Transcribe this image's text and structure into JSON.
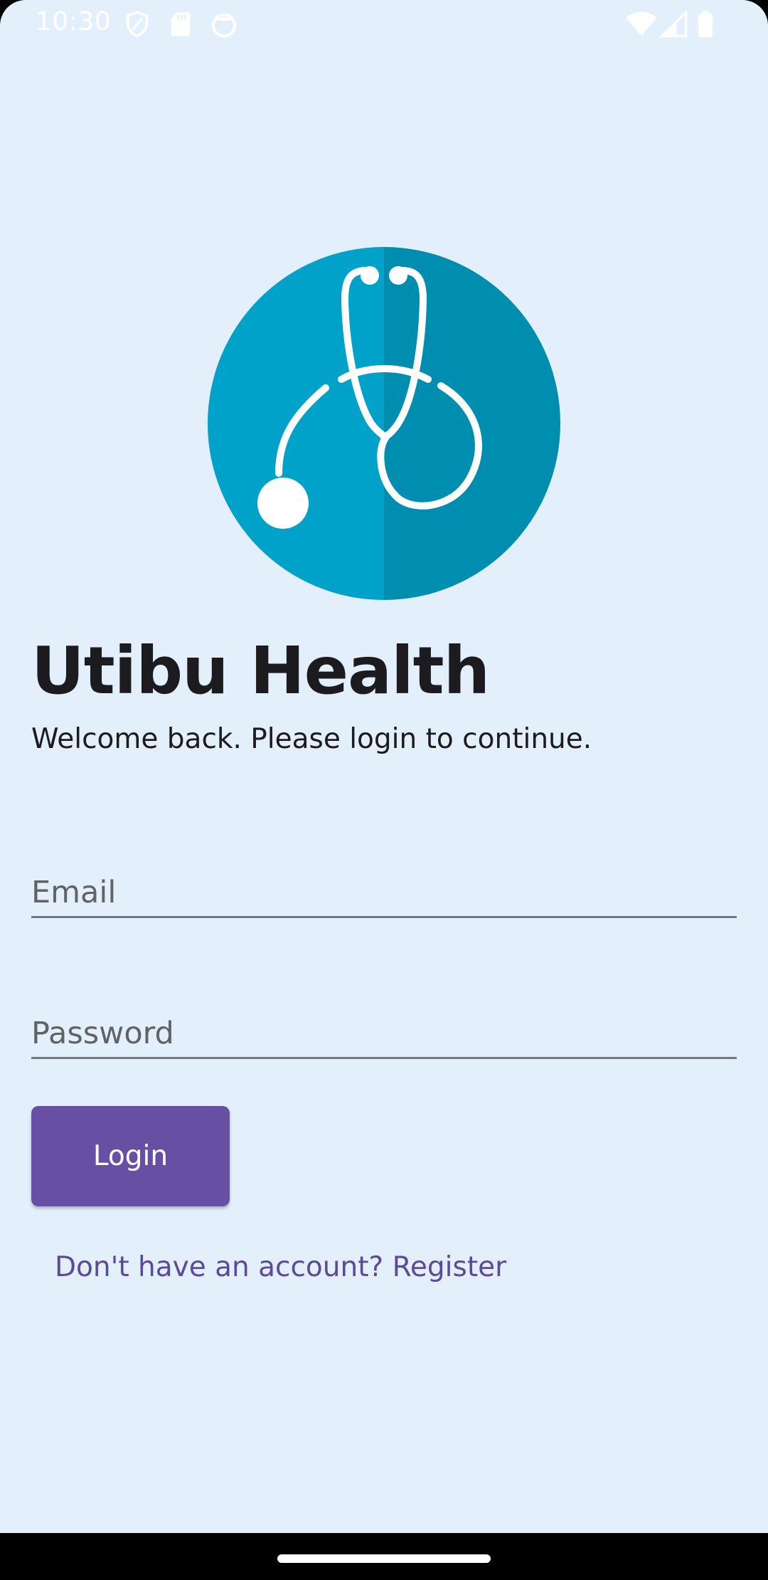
{
  "status_bar": {
    "time": "10:30",
    "left_icons": [
      "shield-icon",
      "sd-card-icon",
      "face-icon"
    ],
    "right_icons": [
      "wifi-icon",
      "signal-icon",
      "battery-icon"
    ]
  },
  "logo": {
    "icon": "stethoscope-icon",
    "colors": {
      "left": "#00a2c9",
      "right": "#008eb0",
      "fg": "#ffffff"
    }
  },
  "header": {
    "title": "Utibu Health",
    "subtitle": "Welcome back. Please login to continue."
  },
  "form": {
    "email": {
      "placeholder": "Email",
      "value": ""
    },
    "password": {
      "placeholder": "Password",
      "value": ""
    },
    "login_label": "Login",
    "register_label": "Don't have an account? Register"
  },
  "theme": {
    "background": "#e3f0fb",
    "primary": "#6750a4",
    "text": "#1c1b1f"
  }
}
